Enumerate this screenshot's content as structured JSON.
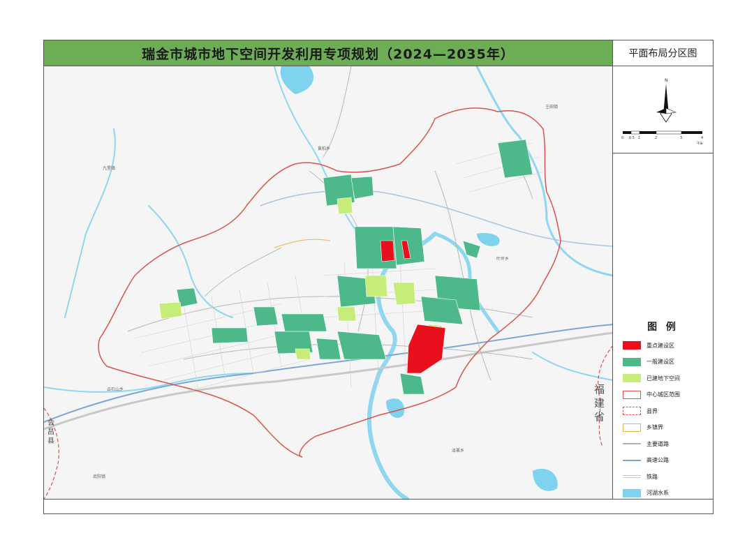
{
  "header": {
    "title": "瑞金市城市地下空间开发利用专项规划（2024—2035年）",
    "map_name": "平面布局分区图"
  },
  "compass": {
    "north_label": "N",
    "scale_ticks": [
      "0",
      "0.5",
      "1",
      "2",
      "3",
      "4"
    ],
    "scale_unit": "千米"
  },
  "legend": {
    "title": "图 例",
    "items": [
      {
        "label": "重点建设区",
        "color": "#e8101c",
        "kind": "fill"
      },
      {
        "label": "一般建设区",
        "color": "#4db88a",
        "kind": "fill"
      },
      {
        "label": "已建地下空间",
        "color": "#c6ec7a",
        "kind": "fill"
      },
      {
        "label": "中心城区范围",
        "color": "#d9534f",
        "kind": "outline"
      },
      {
        "label": "县界",
        "color": "#d9534f",
        "kind": "dashed"
      },
      {
        "label": "乡镇界",
        "color": "#f0b04a",
        "kind": "outline"
      },
      {
        "label": "主要道路",
        "color": "#b0b0b0",
        "kind": "line"
      },
      {
        "label": "高速公路",
        "color": "#7aa7d6",
        "kind": "line"
      },
      {
        "label": "铁路",
        "color": "#c8c8c8",
        "kind": "double"
      },
      {
        "label": "河湖水系",
        "color": "#7fd3ee",
        "kind": "fill"
      }
    ]
  },
  "places": {
    "jiubao": "九堡镇",
    "huangbai": "黄柏乡",
    "renshi": "壬田镇",
    "yeping": "叶坪乡",
    "yunshishan": "云石山乡",
    "zeqian": "泽覃乡",
    "wuyang": "武阳镇",
    "province": "福 建 省",
    "county": "会 昌 县"
  }
}
